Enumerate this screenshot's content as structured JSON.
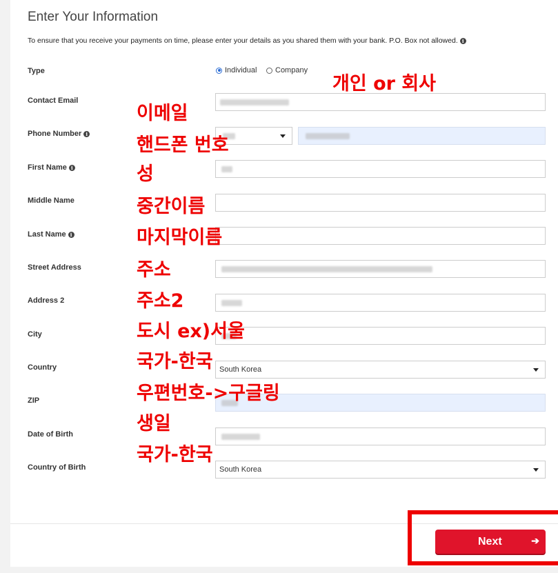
{
  "form": {
    "title": "Enter Your Information",
    "notice": "To ensure that you receive your payments on time, please enter your details as you shared them with your bank. P.O. Box not allowed.",
    "info_icon_glyph": "i",
    "type_label": "Type",
    "type_options": [
      "Individual",
      "Company"
    ],
    "type_selected": "Individual",
    "contact_email_label": "Contact Email",
    "phone_label": "Phone Number",
    "first_name_label": "First Name",
    "middle_name_label": "Middle Name",
    "last_name_label": "Last Name",
    "street_label": "Street Address",
    "address2_label": "Address 2",
    "city_label": "City",
    "country_label": "Country",
    "country_value": "South Korea",
    "zip_label": "ZIP",
    "dob_label": "Date of Birth",
    "country_birth_label": "Country of Birth",
    "country_birth_value": "South Korea"
  },
  "annotations": {
    "type": "개인 or 회사",
    "email": "이메일",
    "phone": "핸드폰 번호",
    "first": "성",
    "middle": "중간이름",
    "last": "마지막이름",
    "street": "주소",
    "address2": "주소2",
    "city": "도시 ex)서울",
    "country": "국가-한국",
    "zip": "우편번호->구글링",
    "dob": "생일",
    "country_birth": "국가-한국"
  },
  "footer": {
    "next_label": "Next",
    "next_arrow": "➔"
  },
  "colors": {
    "accent_red": "#e0142b",
    "annotation_red": "#ee0000",
    "autofill_blue": "#e8f0fe"
  }
}
